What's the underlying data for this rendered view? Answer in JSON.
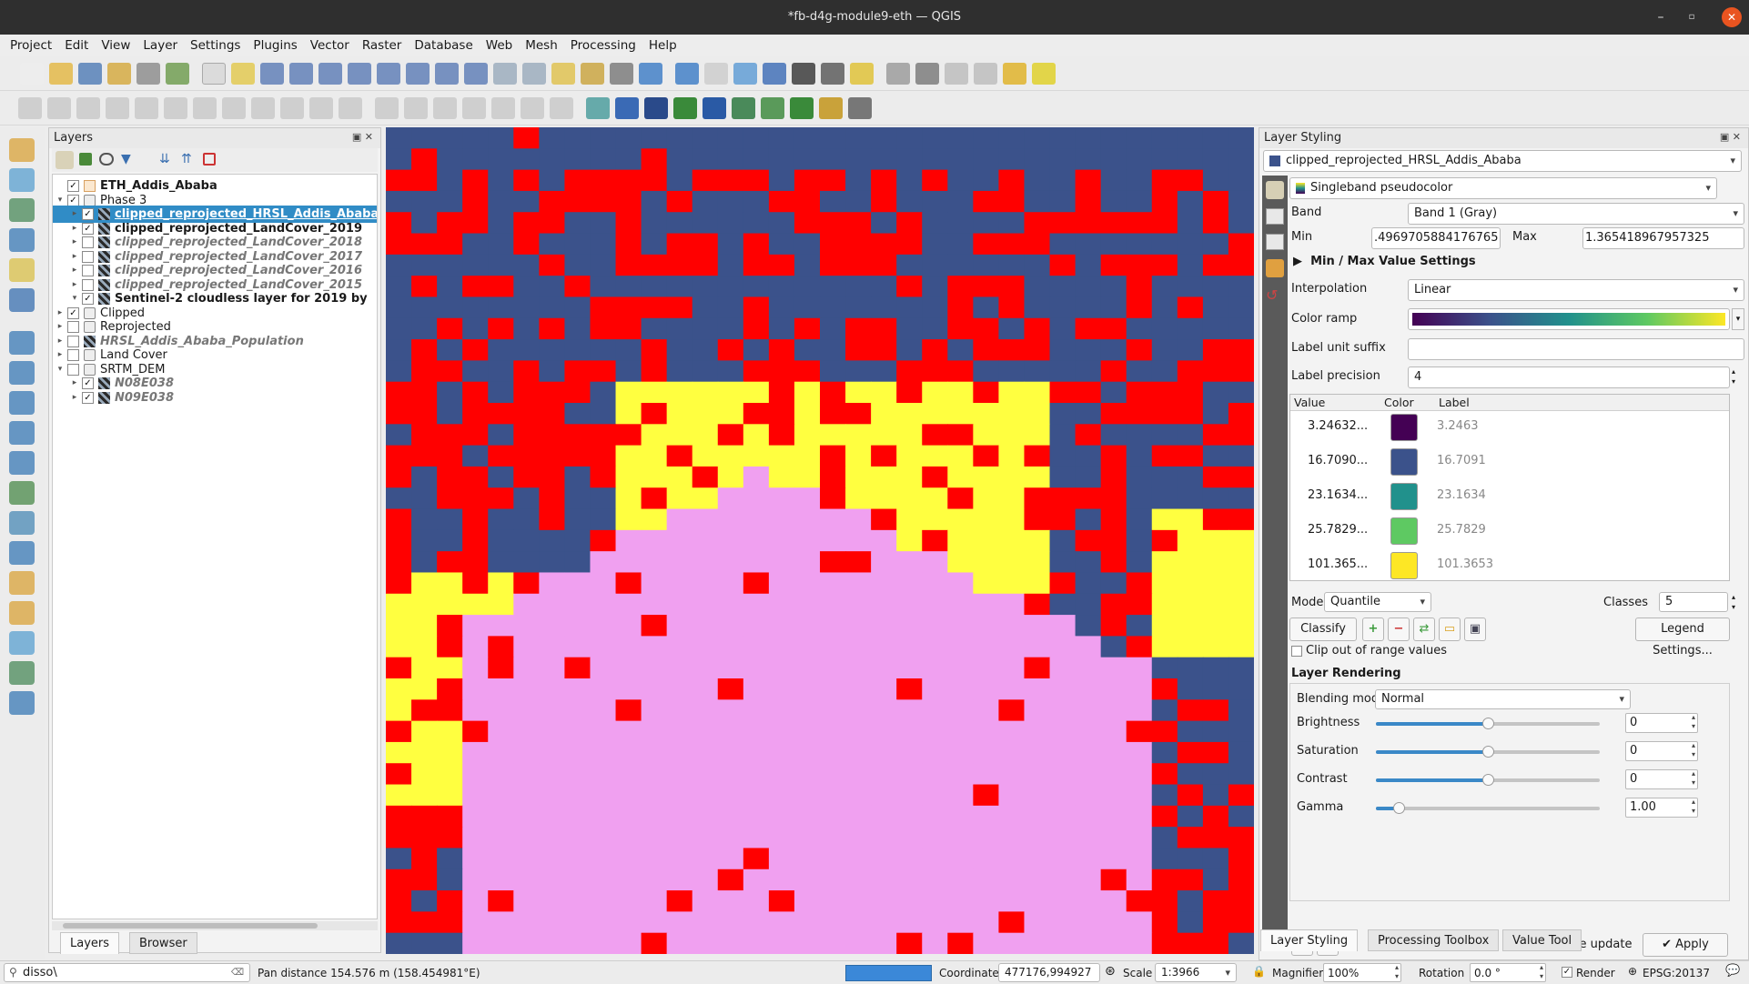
{
  "window": {
    "title": "*fb-d4g-module9-eth — QGIS"
  },
  "menu": [
    "Project",
    "Edit",
    "View",
    "Layer",
    "Settings",
    "Plugins",
    "Vector",
    "Raster",
    "Database",
    "Web",
    "Mesh",
    "Processing",
    "Help"
  ],
  "layers_panel": {
    "title": "Layers",
    "tabs": [
      "Layers",
      "Browser"
    ],
    "rows": [
      {
        "label": "ETH_Addis_Ababa",
        "checked": true,
        "bold": true,
        "italic": false,
        "indent": 0,
        "expander": "",
        "icon": "polygon-layer-icon"
      },
      {
        "label": "Phase 3",
        "checked": true,
        "bold": false,
        "italic": false,
        "indent": 0,
        "expander": "▾",
        "icon": "group-icon"
      },
      {
        "label": "clipped_reprojected_HRSL_Addis_Ababa",
        "checked": true,
        "bold": true,
        "italic": false,
        "indent": 1,
        "expander": "▸",
        "icon": "raster-layer-icon",
        "selected": true
      },
      {
        "label": "clipped_reprojected_LandCover_2019",
        "checked": true,
        "bold": true,
        "italic": false,
        "indent": 1,
        "expander": "▸",
        "icon": "raster-layer-icon"
      },
      {
        "label": "clipped_reprojected_LandCover_2018",
        "checked": false,
        "bold": true,
        "italic": true,
        "indent": 1,
        "expander": "▸",
        "icon": "raster-layer-icon"
      },
      {
        "label": "clipped_reprojected_LandCover_2017",
        "checked": false,
        "bold": true,
        "italic": true,
        "indent": 1,
        "expander": "▸",
        "icon": "raster-layer-icon"
      },
      {
        "label": "clipped_reprojected_LandCover_2016",
        "checked": false,
        "bold": true,
        "italic": true,
        "indent": 1,
        "expander": "▸",
        "icon": "raster-layer-icon"
      },
      {
        "label": "clipped_reprojected_LandCover_2015",
        "checked": false,
        "bold": true,
        "italic": true,
        "indent": 1,
        "expander": "▸",
        "icon": "raster-layer-icon"
      },
      {
        "label": "Sentinel-2 cloudless layer for 2019 by",
        "checked": true,
        "bold": true,
        "italic": false,
        "indent": 1,
        "expander": "▾",
        "icon": "raster-layer-icon"
      },
      {
        "label": "Clipped",
        "checked": true,
        "bold": false,
        "italic": false,
        "indent": 0,
        "expander": "▸",
        "icon": "group-icon"
      },
      {
        "label": "Reprojected",
        "checked": false,
        "bold": false,
        "italic": false,
        "indent": 0,
        "expander": "▸",
        "icon": "group-icon"
      },
      {
        "label": "HRSL_Addis_Ababa_Population",
        "checked": false,
        "bold": true,
        "italic": true,
        "indent": 0,
        "expander": "▸",
        "icon": "raster-layer-icon"
      },
      {
        "label": "Land Cover",
        "checked": false,
        "bold": false,
        "italic": false,
        "indent": 0,
        "expander": "▸",
        "icon": "group-icon"
      },
      {
        "label": "SRTM_DEM",
        "checked": false,
        "bold": false,
        "italic": false,
        "indent": 0,
        "expander": "▾",
        "icon": "group-icon"
      },
      {
        "label": "N08E038",
        "checked": true,
        "bold": true,
        "italic": true,
        "indent": 1,
        "expander": "▸",
        "icon": "raster-layer-icon"
      },
      {
        "label": "N09E038",
        "checked": true,
        "bold": true,
        "italic": true,
        "indent": 1,
        "expander": "▸",
        "icon": "raster-layer-icon"
      }
    ]
  },
  "styling": {
    "title": "Layer Styling",
    "layer": "clipped_reprojected_HRSL_Addis_Ababa",
    "renderer": "Singleband pseudocolor",
    "band_label": "Band",
    "band": "Band 1 (Gray)",
    "min_label": "Min",
    "min": ".4969705884176765",
    "max_label": "Max",
    "max": "1.365418967957325",
    "minmax_section": "Min / Max Value Settings",
    "interp_label": "Interpolation",
    "interpolation": "Linear",
    "ramp_label": "Color ramp",
    "suffix_label": "Label unit suffix",
    "suffix": "",
    "precision_label": "Label precision",
    "precision": "4",
    "table_headers": [
      "Value",
      "Color",
      "Label"
    ],
    "classes": [
      {
        "value": "3.24632...",
        "color": "#440154",
        "label": "3.2463"
      },
      {
        "value": "16.7090...",
        "color": "#3b528b",
        "label": "16.7091"
      },
      {
        "value": "23.1634...",
        "color": "#21918c",
        "label": "23.1634"
      },
      {
        "value": "25.7829...",
        "color": "#5ec962",
        "label": "25.7829"
      },
      {
        "value": "101.365...",
        "color": "#fde725",
        "label": "101.3653"
      }
    ],
    "mode_label": "Mode",
    "mode": "Quantile",
    "classes_label": "Classes",
    "classes_count": "5",
    "classify": "Classify",
    "legend_settings": "Legend Settings...",
    "clip": "Clip out of range values",
    "rendering_section": "Layer Rendering",
    "blending_label": "Blending mode",
    "blending": "Normal",
    "sliders": [
      {
        "label": "Brightness",
        "value": "0",
        "pos": 0.5
      },
      {
        "label": "Saturation",
        "value": "0",
        "pos": 0.5
      },
      {
        "label": "Contrast",
        "value": "0",
        "pos": 0.5
      },
      {
        "label": "Gamma",
        "value": "1.00",
        "pos": 0.1
      }
    ],
    "live_update": "Live update",
    "apply": "Apply",
    "bottom_tabs": [
      "Layer Styling",
      "Processing Toolbox",
      "Value Tool"
    ]
  },
  "map_colors": [
    "#ff0000",
    "#3b528b",
    "#ffff40",
    "#f0a0f0"
  ],
  "status": {
    "search": "disso\\",
    "message": "Pan distance 154.576 m (158.454981°E)",
    "coord_label": "Coordinate",
    "coordinate": "477176,994927",
    "scale_label": "Scale",
    "scale": "1:3966",
    "magnifier_label": "Magnifier",
    "magnifier": "100%",
    "rotation_label": "Rotation",
    "rotation": "0.0 °",
    "render": "Render",
    "crs": "EPSG:20137"
  }
}
